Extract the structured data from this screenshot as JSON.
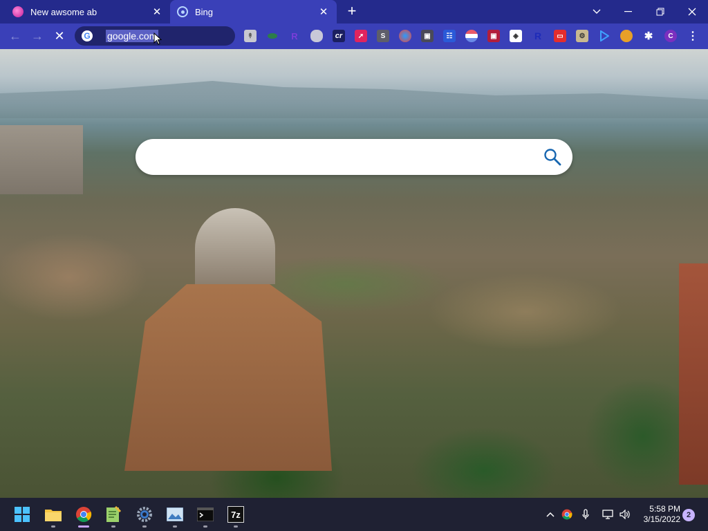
{
  "browser": {
    "tabs": [
      {
        "title": "New awsome ab",
        "active": false
      },
      {
        "title": "Bing",
        "active": true
      }
    ],
    "new_tab_label": "+",
    "address_bar": {
      "value": "google.com"
    },
    "extension_labels": [
      "R",
      "cr",
      "S",
      "R",
      "C"
    ]
  },
  "page": {
    "search": {
      "placeholder": "",
      "value": ""
    },
    "background": "Rome cityscape with Roman Forum and church dome"
  },
  "taskbar": {
    "apps": [
      "start",
      "file-explorer",
      "chrome",
      "notepad-plus",
      "settings",
      "photos",
      "terminal",
      "7zip"
    ],
    "sevenzip_label": "7z",
    "clock": {
      "time": "5:58 PM",
      "date": "3/15/2022"
    },
    "notification_count": "2"
  },
  "colors": {
    "tabstrip": "#242a8c",
    "toolbar": "#3a40b8",
    "taskbar": "#1f2133",
    "accent": "#c9a4ff"
  }
}
